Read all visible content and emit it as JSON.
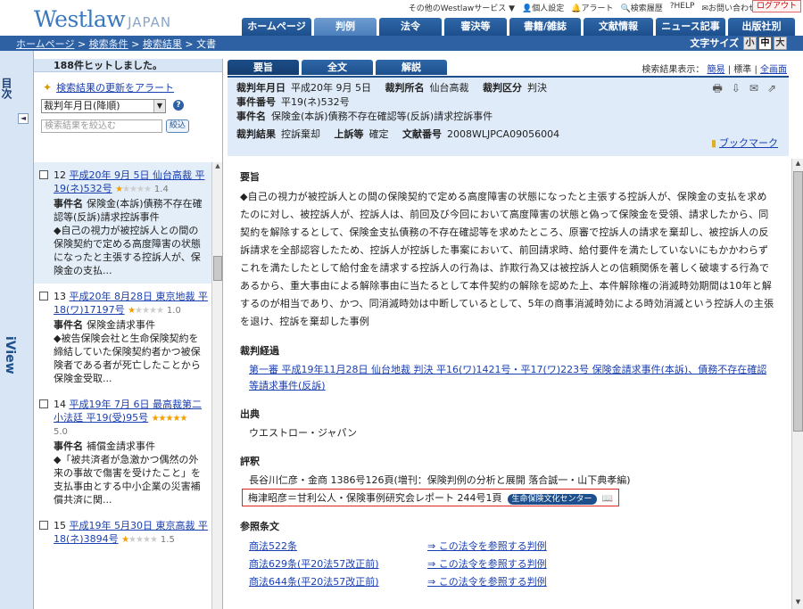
{
  "header": {
    "logo_main": "Westlaw",
    "logo_sub": "JAPAN",
    "util_links": [
      "その他のWestlawサービス ▼",
      "個人設定",
      "アラート",
      "検索履歴",
      "HELP",
      "お問い合わせ"
    ],
    "logout": "ログアウト",
    "nav_tabs": [
      {
        "label": "ホームページ",
        "active": false
      },
      {
        "label": "判例",
        "active": true
      },
      {
        "label": "法令",
        "active": false
      },
      {
        "label": "審決等",
        "active": false
      },
      {
        "label": "書籍/雑誌",
        "active": false
      },
      {
        "label": "文献情報",
        "active": false
      },
      {
        "label": "ニュース記事",
        "active": false
      },
      {
        "label": "出版社別",
        "active": false
      }
    ]
  },
  "topbar": {
    "breadcrumb": [
      "ホームページ",
      "検索条件",
      "検索結果",
      "文書"
    ],
    "fontsize_label": "文字サイズ",
    "fontsize_options": [
      "小",
      "中",
      "大"
    ],
    "fontsize_selected": "中"
  },
  "leftstrip": {
    "mokuji": "目次",
    "iview": "iView",
    "collapse": "◄"
  },
  "results": {
    "hits": "188件ヒットしました。",
    "alert_link": "検索結果の更新をアラート",
    "sort_value": "裁判年月日(降順)",
    "filter_placeholder": "検索結果を絞込む",
    "filter_button": "絞込",
    "items": [
      {
        "no": "12",
        "title": "平成20年 9月 5日 仙台高裁 平19(ネ)532号",
        "stars": 1,
        "score": "1.4",
        "case_label": "事件名",
        "case_name": "保険金(本訴)債務不存在確認等(反訴)請求控訴事件",
        "summary": "◆自己の視力が被控訴人との間の保険契約で定める高度障害の状態になったと主張する控訴人が、保険金の支払...",
        "selected": true
      },
      {
        "no": "13",
        "title": "平成20年 8月28日 東京地裁 平18(ワ)17197号",
        "stars": 1,
        "score": "1.0",
        "case_label": "事件名",
        "case_name": "保険金請求事件",
        "summary": "◆被告保険会社と生命保険契約を締結していた保険契約者かつ被保険者である者が死亡したことから保険金受取...",
        "selected": false
      },
      {
        "no": "14",
        "title": "平成19年 7月 6日 最高裁第二小法廷 平19(受)95号",
        "stars": 5,
        "score": "5.0",
        "case_label": "事件名",
        "case_name": "補償金請求事件",
        "summary": "◆「被共済者が急激かつ偶然の外来の事故で傷害を受けたこと」を支払事由とする中小企業の災害補償共済に関...",
        "selected": false
      },
      {
        "no": "15",
        "title": "平成19年 5月30日 東京高裁 平18(ネ)3894号",
        "stars": 1,
        "score": "1.5",
        "case_label": "",
        "case_name": "",
        "summary": "",
        "selected": false
      }
    ]
  },
  "doc": {
    "tabs": [
      {
        "label": "要旨",
        "active": true
      },
      {
        "label": "全文",
        "active": false
      },
      {
        "label": "解説",
        "active": false
      }
    ],
    "display_mode_label": "検索結果表示：",
    "display_modes": [
      "簡易",
      "標準",
      "全画面"
    ],
    "meta": {
      "date_label": "裁判年月日",
      "date": "平成20年 9月 5日",
      "court_label": "裁判所名",
      "court": "仙台高裁",
      "type_label": "裁判区分",
      "type": "判決",
      "number_label": "事件番号",
      "number": "平19(ネ)532号",
      "name_label": "事件名",
      "name": "保険金(本訴)債務不存在確認等(反訴)請求控訴事件",
      "result_label": "裁判結果",
      "result": "控訴棄却",
      "appeal_label": "上訴等",
      "appeal": "確定",
      "docno_label": "文献番号",
      "docno": "2008WLJPCA09056004"
    },
    "bookmark": "ブックマーク",
    "sections": {
      "summary_head": "要旨",
      "summary": "◆自己の視力が被控訴人との間の保険契約で定める高度障害の状態になったと主張する控訴人が、保険金の支払を求めたのに対し、被控訴人が、控訴人は、前回及び今回において高度障害の状態と偽って保険金を受領、請求したから、同契約を解除するとして、保険金支払債務の不存在確認等を求めたところ、原審で控訴人の請求を棄却し、被控訴人の反訴請求を全部認容したため、控訴人が控訴した事案において、前回請求時、給付要件を満たしていないにもかかわらずこれを満たしたとして給付金を請求する控訴人の行為は、詐欺行為又は被控訴人との信頼関係を著しく破壊する行為であるから、重大事由による解除事由に当たるとして本件契約の解除を認めた上、本件解除権の消滅時効期間は10年と解するのが相当であり、かつ、同消滅時効は中断しているとして、5年の商事消滅時効による時効消滅という控訴人の主張を退け、控訴を棄却した事例",
      "history_head": "裁判経過",
      "history_link": "第一審 平成19年11月28日 仙台地裁 判決 平16(ワ)1421号・平17(ワ)223号 保険金請求事件(本訴)、債務不存在確認等請求事件(反訴)",
      "source_head": "出典",
      "source": "ウエストロー・ジャパン",
      "commentary_head": "評釈",
      "commentary_1": "長谷川仁彦・金商 1386号126頁(増刊：保険判例の分析と展開 落合誠一・山下典孝編)",
      "commentary_2": "梅津昭彦＝甘利公人・保険事例研究会レポート 244号1頁",
      "commentary_badge": "生命保険文化センター",
      "refs_head": "参照条文",
      "refs": [
        {
          "law": "商法522条",
          "link": "⇒ この法令を参照する判例"
        },
        {
          "law": "商法629条(平20法57改正前)",
          "link": "⇒ この法令を参照する判例"
        },
        {
          "law": "商法644条(平20法57改正前)",
          "link": "⇒ この法令を参照する判例"
        }
      ]
    }
  }
}
